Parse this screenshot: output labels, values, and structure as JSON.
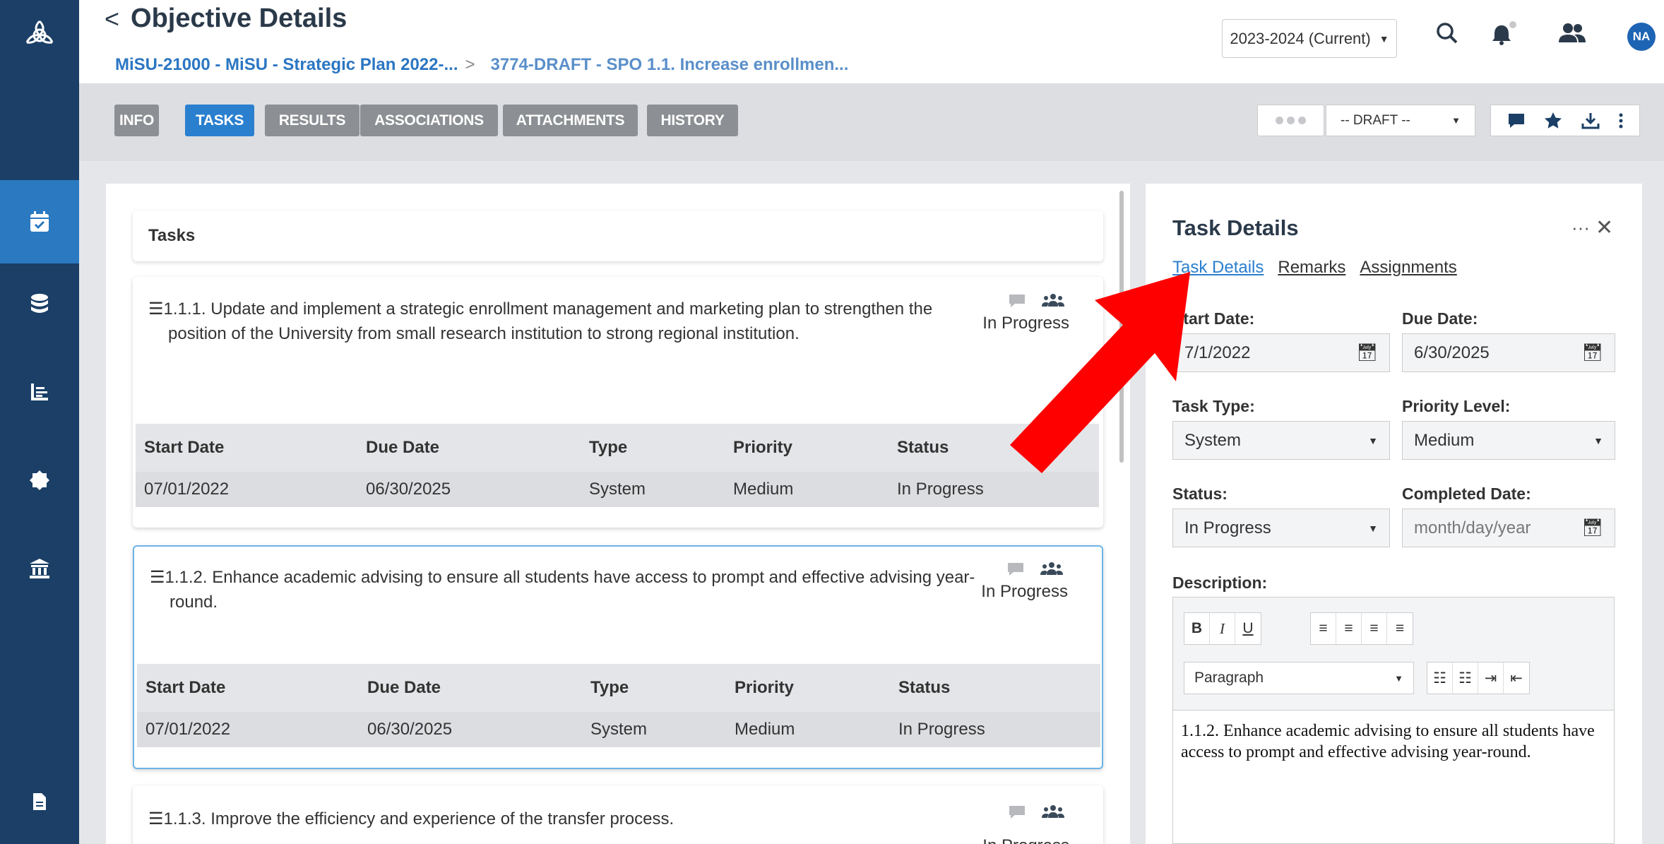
{
  "header": {
    "title": "Objective Details",
    "breadcrumb_1": "MiSU-21000 - MiSU - Strategic Plan 2022-...",
    "breadcrumb_sep": ">",
    "breadcrumb_2": "3774-DRAFT - SPO 1.1. Increase enrollmen...",
    "year_selector": "2023-2024 (Current)",
    "avatar_initials": "NA"
  },
  "tabs": [
    {
      "label": "INFO"
    },
    {
      "label": "TASKS"
    },
    {
      "label": "RESULTS"
    },
    {
      "label": "ASSOCIATIONS"
    },
    {
      "label": "ATTACHMENTS"
    },
    {
      "label": "HISTORY"
    }
  ],
  "active_tab": "TASKS",
  "status_dropdown": "-- DRAFT --",
  "tasks_header": "Tasks",
  "table_headers": {
    "start": "Start Date",
    "due": "Due Date",
    "type": "Type",
    "priority": "Priority",
    "status": "Status"
  },
  "tasks": [
    {
      "text": "1.1.1. Update and implement a strategic enrollment management and marketing plan to strengthen the position of the University from small research institution to strong regional institution.",
      "status": "In Progress",
      "start": "07/01/2022",
      "due": "06/30/2025",
      "type": "System",
      "priority": "Medium",
      "row_status": "In Progress"
    },
    {
      "text": "1.1.2. Enhance academic advising to ensure all students have access to prompt and effective advising year-round.",
      "status": "In Progress",
      "start": "07/01/2022",
      "due": "06/30/2025",
      "type": "System",
      "priority": "Medium",
      "row_status": "In Progress"
    },
    {
      "text": "1.1.3. Improve the efficiency and experience of the transfer process.",
      "status": "In Progress"
    }
  ],
  "task_details": {
    "title": "Task Details",
    "links": [
      "Task Details",
      "Remarks",
      "Assignments"
    ],
    "start_label": "Start Date:",
    "start_value": "7/1/2022",
    "due_label": "Due Date:",
    "due_value": "6/30/2025",
    "type_label": "Task Type:",
    "type_value": "System",
    "priority_label": "Priority Level:",
    "priority_value": "Medium",
    "status_label": "Status:",
    "status_value": "In Progress",
    "completed_label": "Completed Date:",
    "completed_placeholder": "month/day/year",
    "description_label": "Description:",
    "paragraph_select": "Paragraph",
    "description_text": "1.1.2. Enhance academic advising to ensure all students have access to prompt and effective advising year-round."
  },
  "colors": {
    "sidebar": "#1b3f66",
    "active": "#2a7fcf",
    "arrow": "#ff0000"
  }
}
